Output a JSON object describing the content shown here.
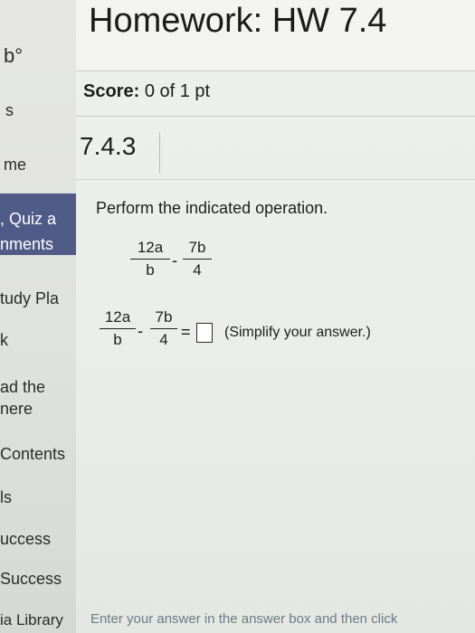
{
  "sidebar": {
    "items": [
      {
        "label": "b°"
      },
      {
        "label": "s"
      },
      {
        "label": "me"
      },
      {
        "label": ", Quiz a"
      },
      {
        "label": "nments"
      },
      {
        "label": "tudy Pla"
      },
      {
        "label": "k"
      },
      {
        "label": "ad the"
      },
      {
        "label": "nere"
      },
      {
        "label": "Contents"
      },
      {
        "label": "ls"
      },
      {
        "label": "uccess"
      },
      {
        "label": "Success"
      },
      {
        "label": "ia Library"
      }
    ]
  },
  "header": {
    "title": "Homework: HW 7.4"
  },
  "score": {
    "label": "Score:",
    "value": "0 of 1 pt"
  },
  "question": {
    "number": "7.4.3",
    "instruction": "Perform the indicated operation.",
    "expression": {
      "frac1_num": "12a",
      "frac1_den": "b",
      "operator": "-",
      "frac2_num": "7b",
      "frac2_den": "4",
      "equals": "="
    },
    "simplify_hint": "(Simplify your answer.)"
  },
  "footer": {
    "hint": "Enter your answer in the answer box and then click"
  },
  "colors": {
    "sidebar_active": "#4f5a86",
    "background": "#eef0ec"
  }
}
